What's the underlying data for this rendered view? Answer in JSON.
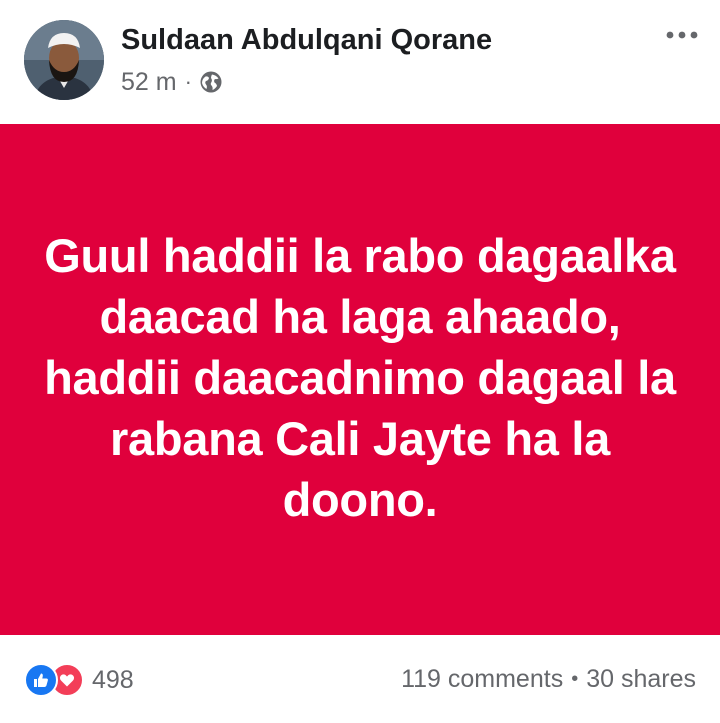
{
  "post": {
    "author": {
      "name": "Suldaan Abdulqani Qorane"
    },
    "timestamp": "52 m",
    "meta_separator": "·",
    "audience_icon": "globe-icon",
    "more_icon": "more-options-icon",
    "banner": {
      "background_color": "#e0003c",
      "text": "Guul haddii la rabo dagaalka daacad ha laga ahaado, haddii daacadnimo dagaal la rabana Cali Jayte ha la doono."
    },
    "reactions": {
      "icons": [
        "like-icon",
        "love-icon"
      ],
      "count": "498"
    },
    "stats": {
      "comments": "119 comments",
      "separator": "•",
      "shares": "30 shares"
    }
  },
  "colors": {
    "like_blue": "#1877f2",
    "love_red": "#f33e58",
    "secondary_text": "#65676b",
    "primary_text": "#1c1e21"
  }
}
